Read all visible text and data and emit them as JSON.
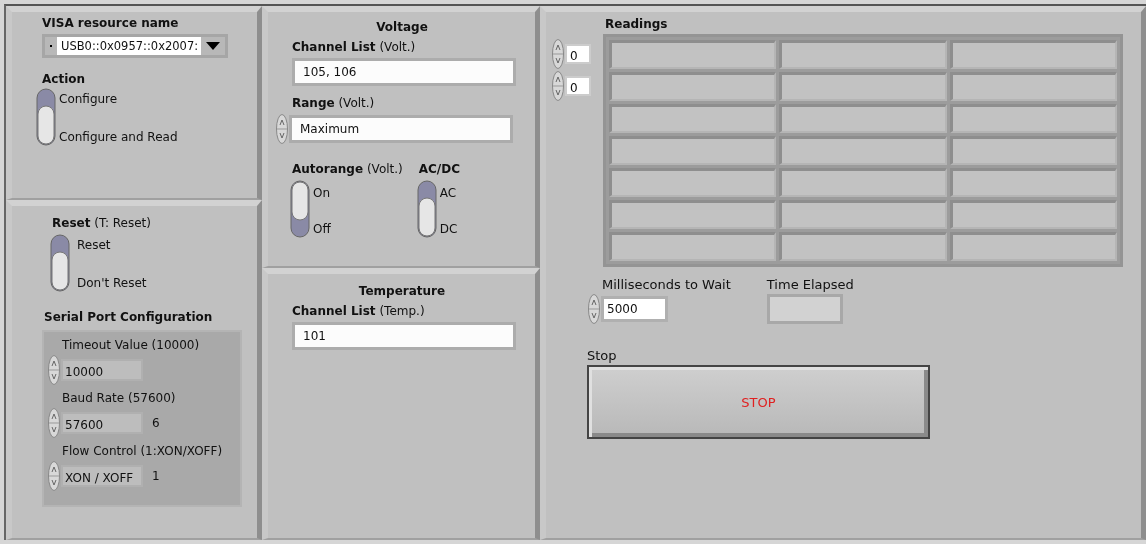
{
  "visa_resource": {
    "label": "VISA resource name",
    "value": "USB0::0x0957::0x2007:"
  },
  "action": {
    "label": "Action",
    "options": [
      "Configure",
      "Configure and Read"
    ],
    "thumb_down": true
  },
  "reset": {
    "label": "**Reset** (T: Reset)",
    "options": [
      "Reset",
      "Don't Reset"
    ],
    "thumb_down": true
  },
  "serial_port": {
    "title": "Serial Port Configuration",
    "fields": [
      {
        "label": "Timeout Value (10000)",
        "value": "10000"
      },
      {
        "label": "Baud Rate (57600)",
        "value": "57600",
        "code": "6"
      },
      {
        "label": "Flow Control (1:XON/XOFF)",
        "value": "XON / XOFF",
        "code": "1"
      }
    ]
  },
  "voltage": {
    "title": "Voltage",
    "channel_list": {
      "label": "**Channel List** (Volt.)",
      "value": "105, 106"
    },
    "range": {
      "label": "**Range** (Volt.)",
      "value": "Maximum"
    },
    "autorange": {
      "label": "**Autorange** (Volt.)",
      "options": [
        "On",
        "Off"
      ],
      "thumb_down": false
    },
    "ac_dc": {
      "label": "AC/DC",
      "options": [
        "AC",
        "DC"
      ],
      "thumb_down": true
    }
  },
  "temperature": {
    "title": "Temperature",
    "channel_list": {
      "label": "**Channel List** (Temp.)",
      "value": "101"
    }
  },
  "readings": {
    "label": "Readings",
    "indexes": [
      "0",
      "0"
    ],
    "rows": [
      {
        "cells": [
          {
            "kind": "empty"
          },
          {
            "kind": "empty"
          },
          {
            "kind": "empty"
          }
        ]
      },
      {
        "cells": [
          {
            "kind": "empty"
          },
          {
            "kind": "empty"
          },
          {
            "kind": "empty"
          }
        ]
      },
      {
        "cells": [
          {
            "kind": "empty"
          },
          {
            "kind": "empty"
          },
          {
            "kind": "empty"
          }
        ]
      },
      {
        "cells": [
          {
            "kind": "empty"
          },
          {
            "kind": "empty"
          },
          {
            "kind": "empty"
          }
        ]
      },
      {
        "cells": [
          {
            "kind": "empty"
          },
          {
            "kind": "empty"
          },
          {
            "kind": "empty"
          }
        ]
      },
      {
        "cells": [
          {
            "kind": "empty"
          },
          {
            "kind": "empty"
          },
          {
            "kind": "empty"
          }
        ]
      },
      {
        "cells": [
          {
            "kind": "empty"
          },
          {
            "kind": "empty"
          },
          {
            "kind": "empty"
          }
        ]
      }
    ]
  },
  "wait": {
    "label": "Milliseconds to Wait",
    "value": "5000"
  },
  "time_elapsed": {
    "label": "Time Elapsed"
  },
  "stop": {
    "label": "Stop",
    "button": "STOP"
  }
}
